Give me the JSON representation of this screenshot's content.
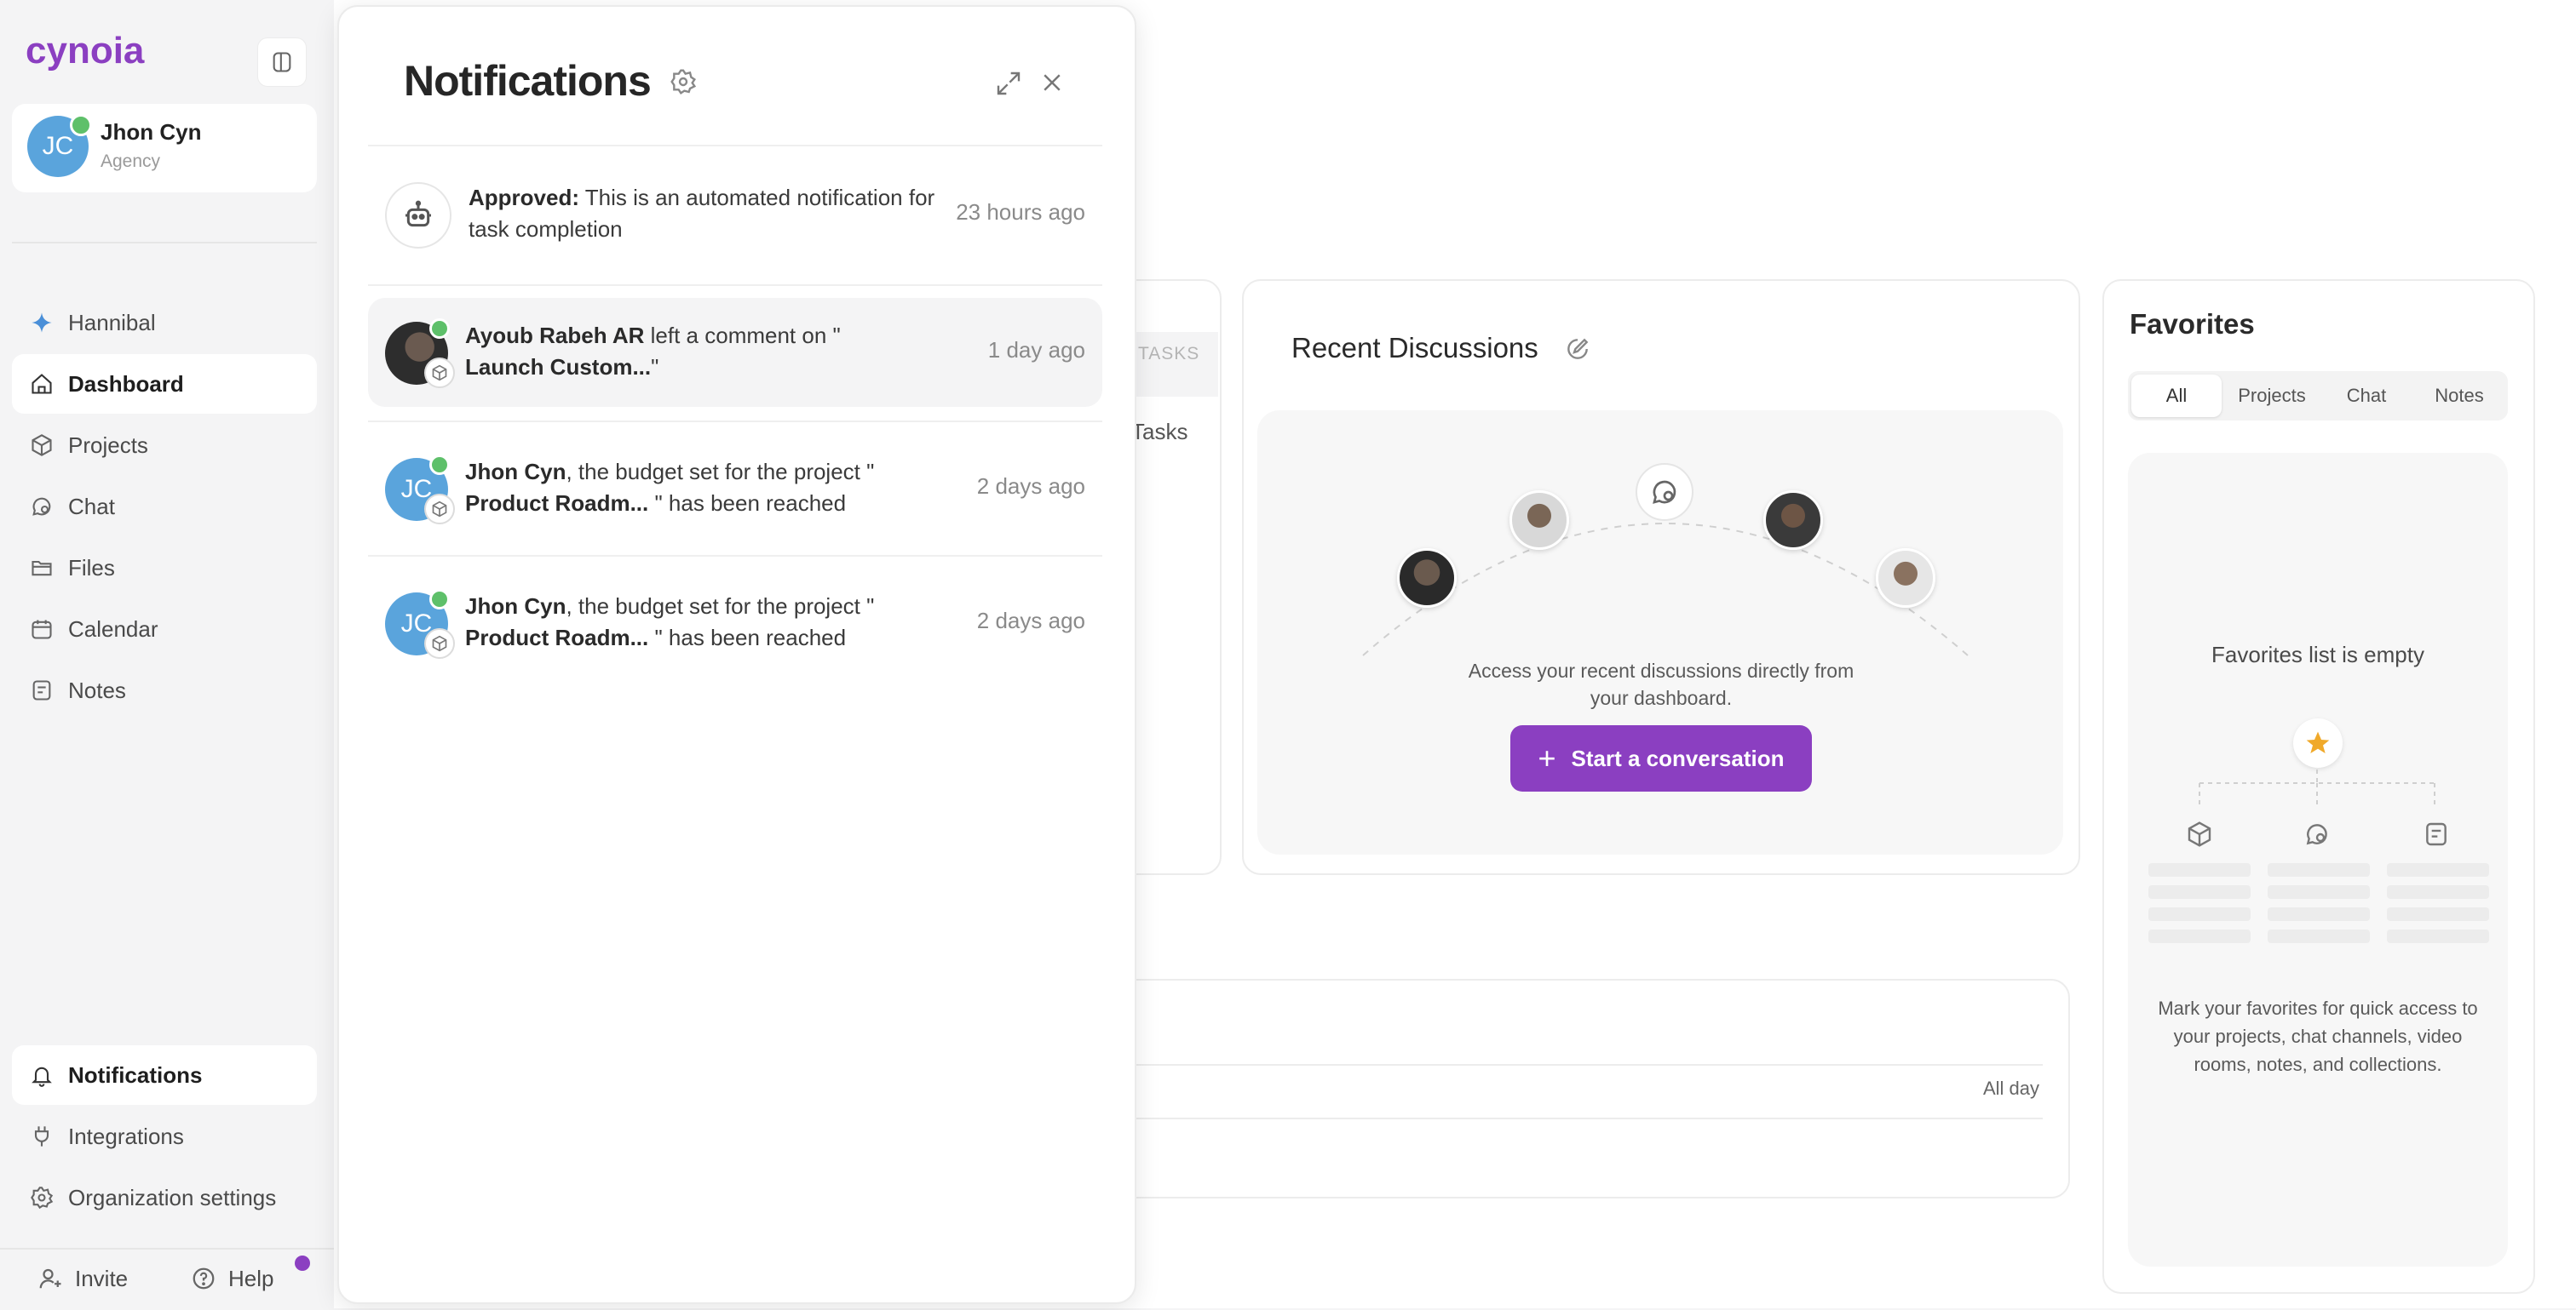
{
  "app": {
    "logo_text": "cynoia"
  },
  "user": {
    "initials": "JC",
    "name": "Jhon Cyn",
    "role": "Agency"
  },
  "nav": {
    "items": [
      {
        "label": "Hannibal",
        "icon": "sparkle-icon"
      },
      {
        "label": "Dashboard",
        "icon": "home-icon"
      },
      {
        "label": "Projects",
        "icon": "cube-icon"
      },
      {
        "label": "Chat",
        "icon": "chat-icon"
      },
      {
        "label": "Files",
        "icon": "folder-icon"
      },
      {
        "label": "Calendar",
        "icon": "calendar-icon"
      },
      {
        "label": "Notes",
        "icon": "note-icon"
      }
    ],
    "bottom": [
      {
        "label": "Notifications",
        "icon": "bell-icon"
      },
      {
        "label": "Integrations",
        "icon": "plug-icon"
      },
      {
        "label": "Organization settings",
        "icon": "gear-icon"
      }
    ],
    "invite_label": "Invite",
    "help_label": "Help"
  },
  "dashboard": {
    "tasks_tab": "TASKS",
    "tasks_link": "Tasks",
    "recent": {
      "title": "Recent Discussions",
      "description": "Access your recent discussions directly from your dashboard.",
      "button": "Start a conversation"
    },
    "calendar": {
      "all_day": "All day"
    },
    "favorites": {
      "title": "Favorites",
      "tabs": [
        "All",
        "Projects",
        "Chat",
        "Notes"
      ],
      "active_tab": "All",
      "empty_title": "Favorites list is empty",
      "description": "Mark your favorites for quick access to your projects, chat channels, video rooms, notes, and collections."
    }
  },
  "notifications": {
    "title": "Notifications",
    "items": [
      {
        "actor": "Approved:",
        "text": " This is an automated notification for task completion",
        "time": "23 hours ago"
      },
      {
        "actor": "Ayoub Rabeh AR",
        "text": " left a comment on \"",
        "subject": "Launch Custom...",
        "suffix": "\"",
        "time": "1 day ago"
      },
      {
        "actor": "Jhon Cyn",
        "text": ", the budget set for the project \"",
        "subject": "Product Roadm...",
        "suffix": " \" has been reached",
        "time": "2 days ago",
        "initials": "JC"
      },
      {
        "actor": "Jhon Cyn",
        "text": ", the budget set for the project \"",
        "subject": "Product Roadm...",
        "suffix": " \" has been reached",
        "time": "2 days ago",
        "initials": "JC"
      }
    ]
  },
  "colors": {
    "accent": "#8b3fc1",
    "avatar_blue": "#5aa4dc",
    "online": "#5ec06a",
    "star": "#f0a92a"
  }
}
